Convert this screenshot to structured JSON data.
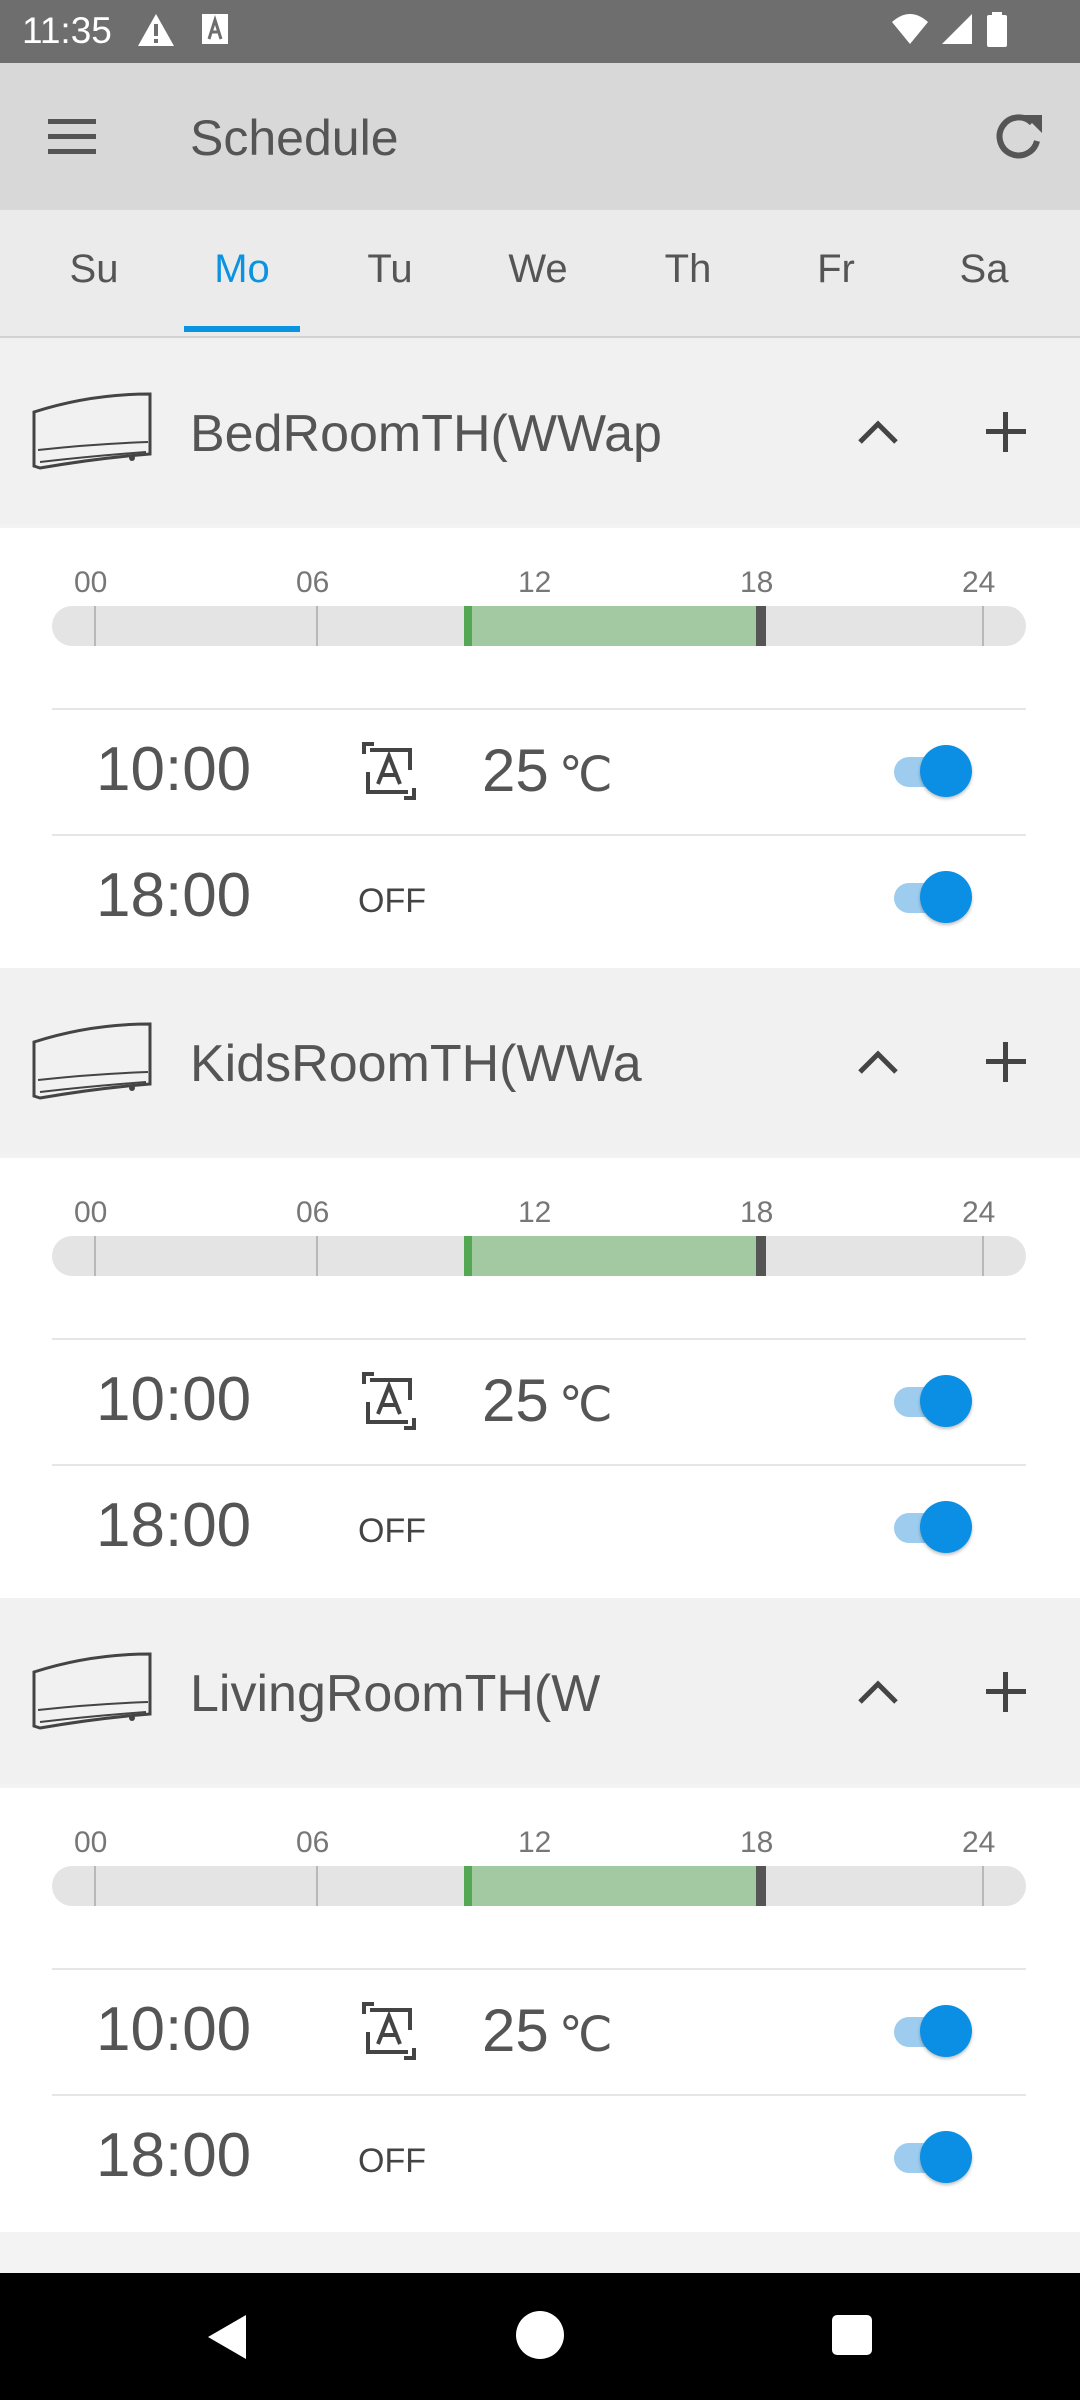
{
  "status_bar": {
    "time": "11:35"
  },
  "app_bar": {
    "title": "Schedule"
  },
  "tabs": [
    {
      "label": "Su",
      "active": false
    },
    {
      "label": "Mo",
      "active": true
    },
    {
      "label": "Tu",
      "active": false
    },
    {
      "label": "We",
      "active": false
    },
    {
      "label": "Th",
      "active": false
    },
    {
      "label": "Fr",
      "active": false
    },
    {
      "label": "Sa",
      "active": false
    }
  ],
  "timeline_labels": [
    "00",
    "06",
    "12",
    "18",
    "24"
  ],
  "rooms": [
    {
      "name": "BedRoomTH(WWap",
      "timeline": {
        "on_start_hour": 10,
        "off_hour": 18
      },
      "entries": [
        {
          "time": "10:00",
          "mode": "auto",
          "temp": "25",
          "unit": "℃",
          "enabled": true
        },
        {
          "time": "18:00",
          "mode_text": "OFF",
          "enabled": true
        }
      ]
    },
    {
      "name": "KidsRoomTH(WWa",
      "timeline": {
        "on_start_hour": 10,
        "off_hour": 18
      },
      "entries": [
        {
          "time": "10:00",
          "mode": "auto",
          "temp": "25",
          "unit": "℃",
          "enabled": true
        },
        {
          "time": "18:00",
          "mode_text": "OFF",
          "enabled": true
        }
      ]
    },
    {
      "name": "LivingRoomTH(W",
      "timeline": {
        "on_start_hour": 10,
        "off_hour": 18
      },
      "entries": [
        {
          "time": "10:00",
          "mode": "auto",
          "temp": "25",
          "unit": "℃",
          "enabled": true
        },
        {
          "time": "18:00",
          "mode_text": "OFF",
          "enabled": true
        }
      ]
    }
  ],
  "colors": {
    "accent": "#0a93e0",
    "timeline_on": "#a3c9a3",
    "timeline_on_start": "#54a854",
    "timeline_off_marker": "#555555",
    "toggle_on": "#0a8fe4"
  }
}
